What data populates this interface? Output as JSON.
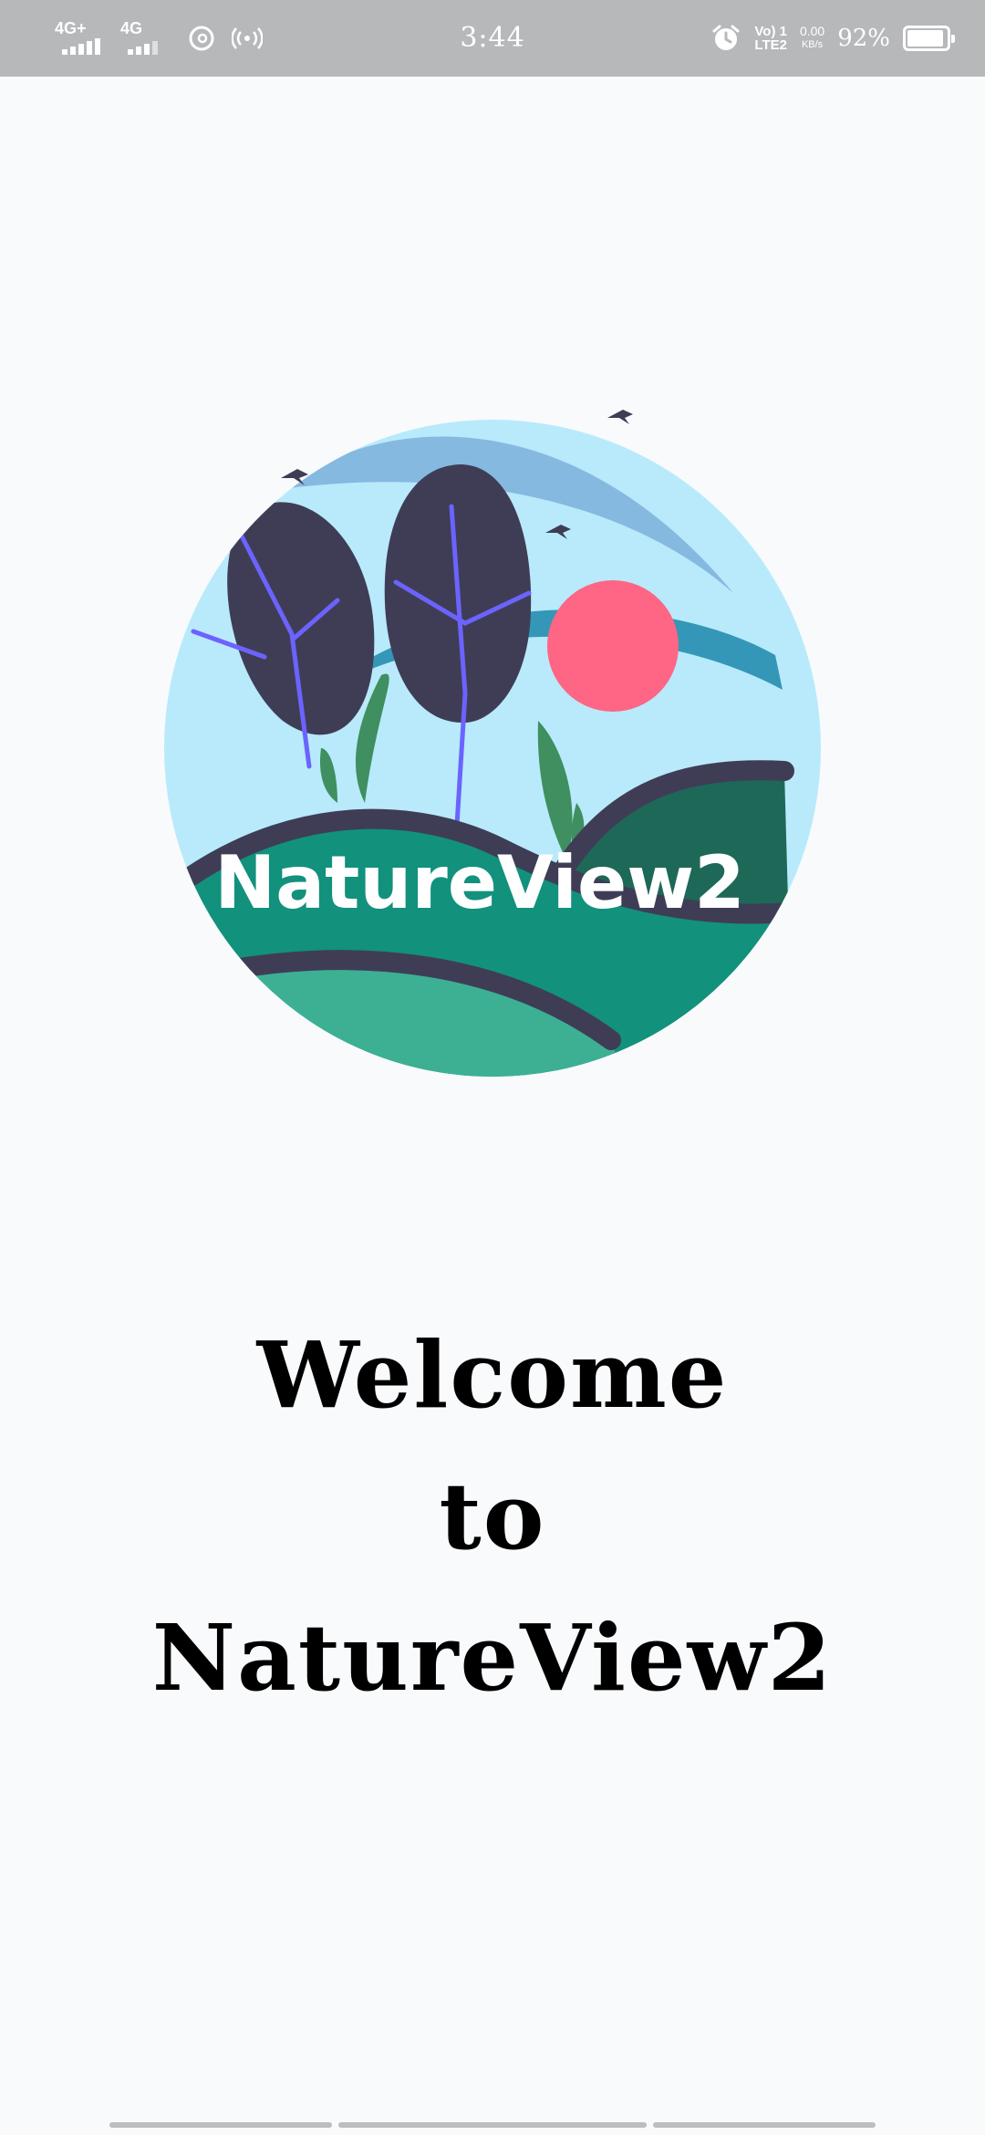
{
  "status_bar": {
    "sim1_network": "4G+",
    "sim2_network": "4G",
    "time": "3:44",
    "volte_line1": "Vo) 1",
    "volte_line2": "LTE2",
    "net_speed_value": "0.00",
    "net_speed_unit": "KB/s",
    "battery_percent": "92%",
    "battery_level": 0.92,
    "icons": [
      "signal-icon",
      "threads-icon",
      "hotspot-icon",
      "alarm-icon",
      "battery-icon"
    ]
  },
  "logo": {
    "text": "NatureView2",
    "colors": {
      "sky": "#B8EAFB",
      "arc_light": "#86B9E0",
      "arc_dark": "#3497B7",
      "sun": "#FF6584",
      "tree": "#3F3D56",
      "vein": "#6C63FF",
      "grass": "#3F8F60",
      "hill_dark": "#1E6858",
      "hill_mid": "#12917D",
      "hill_light": "#3DB094"
    }
  },
  "welcome": {
    "line1": "Welcome",
    "line2": "to",
    "line3": "NatureView2"
  }
}
